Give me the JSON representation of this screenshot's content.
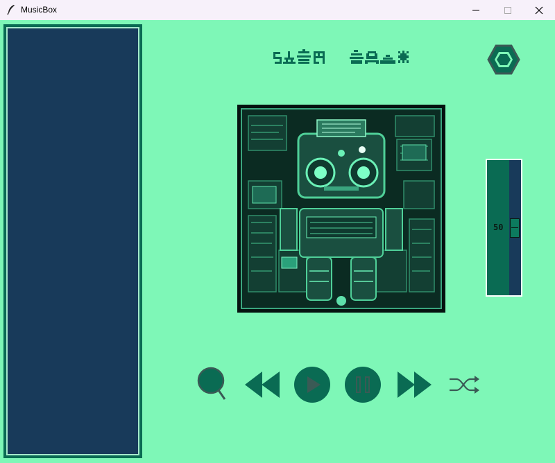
{
  "window": {
    "title": "MusicBox"
  },
  "colors": {
    "background": "#7ef7b7",
    "accent": "#0a6b53",
    "playlist_bg": "#183a5a",
    "dark": "#183a5a"
  },
  "now_playing": {
    "title_glyphs": "▓▒░▓ ▓▒░▓"
  },
  "volume": {
    "value": "50",
    "level": 0.5
  },
  "controls": {
    "icons": [
      "search-icon",
      "previous-icon",
      "play-icon",
      "pause-icon",
      "next-icon",
      "shuffle-icon"
    ]
  },
  "playlist": {
    "items": []
  }
}
